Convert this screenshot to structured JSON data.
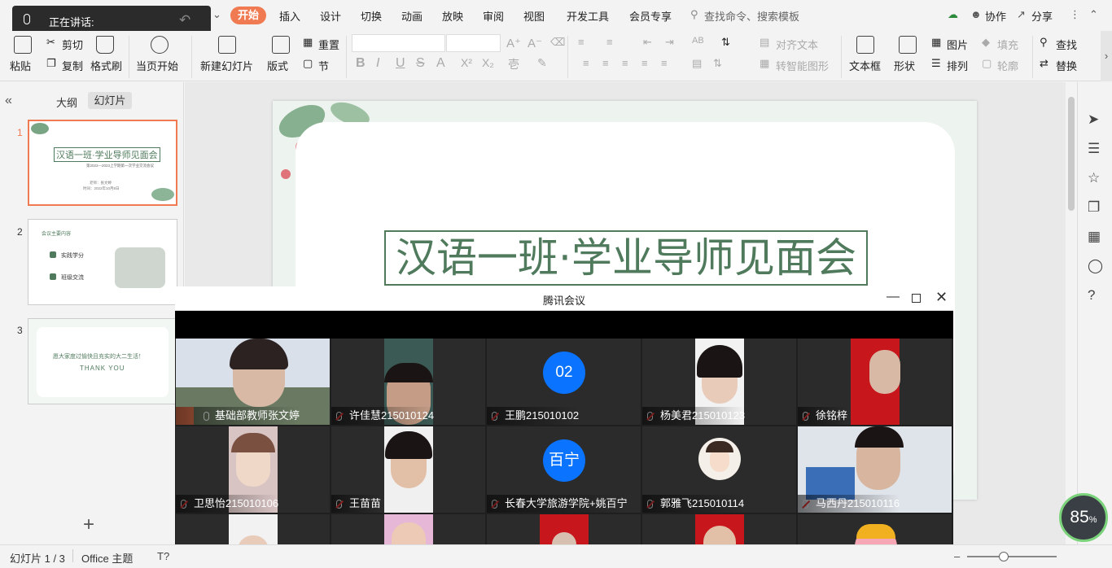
{
  "speaker_bar": {
    "label": "正在讲话:"
  },
  "menu": {
    "tabs": [
      "开始",
      "插入",
      "设计",
      "切换",
      "动画",
      "放映",
      "审阅",
      "视图",
      "开发工具",
      "会员专享"
    ],
    "search_placeholder": "查找命令、搜索模板",
    "collab": "协作",
    "share": "分享"
  },
  "ribbon": {
    "paste": "粘贴",
    "cut": "剪切",
    "copy": "复制",
    "format_painter": "格式刷",
    "play_from_current": "当页开始",
    "new_slide": "新建幻灯片",
    "layout": "版式",
    "section": "节",
    "reset": "重置",
    "align_text": "对齐文本",
    "smart_shape": "转智能图形",
    "textbox": "文本框",
    "shape": "形状",
    "picture": "图片",
    "fill": "填充",
    "arrange": "排列",
    "outline": "轮廓",
    "find": "查找",
    "replace": "替换"
  },
  "left_panel": {
    "tab_outline": "大纲",
    "tab_slides": "幻灯片",
    "slides": [
      {
        "num": "1",
        "title": "汉语一班·学业导师见面会",
        "subtitle": "第2022—2023上学期第一次学业交流会议",
        "line3a": "老师：张文婷",
        "line3b": "时间：2022年10月8日"
      },
      {
        "num": "2",
        "title": "会议主要内容",
        "item1": "实践学分",
        "item2": "班级交流"
      },
      {
        "num": "3",
        "title": "愿大家度过愉快且充实的大二生活！",
        "subtitle": "THANK YOU"
      }
    ]
  },
  "slide": {
    "title": "汉语一班·学业导师见面会"
  },
  "meeting": {
    "window_title": "腾讯会议",
    "participants": [
      {
        "name": "基础部教师张文婷",
        "muted": false
      },
      {
        "name": "许佳慧215010124",
        "muted": true
      },
      {
        "name": "王鹏215010102",
        "muted": true,
        "avatar_text": "02"
      },
      {
        "name": "杨美君215010123",
        "muted": true
      },
      {
        "name": "徐铭梓",
        "muted": true
      },
      {
        "name": "卫思怡215010106",
        "muted": true
      },
      {
        "name": "王苗苗",
        "muted": true
      },
      {
        "name": "长春大学旅游学院+姚百宁",
        "muted": true,
        "avatar_text": "百宁"
      },
      {
        "name": "郭雅飞215010114",
        "muted": true
      },
      {
        "name": "马西丹215010116",
        "muted": true
      }
    ]
  },
  "statusbar": {
    "slide_counter": "幻灯片 1 / 3",
    "theme": "Office 主题"
  },
  "zoom": {
    "value": "85",
    "unit": "%"
  },
  "colors": {
    "accent": "#f07a52",
    "slide_green": "#4f7a5c",
    "avatar_blue": "#0a73ff"
  }
}
